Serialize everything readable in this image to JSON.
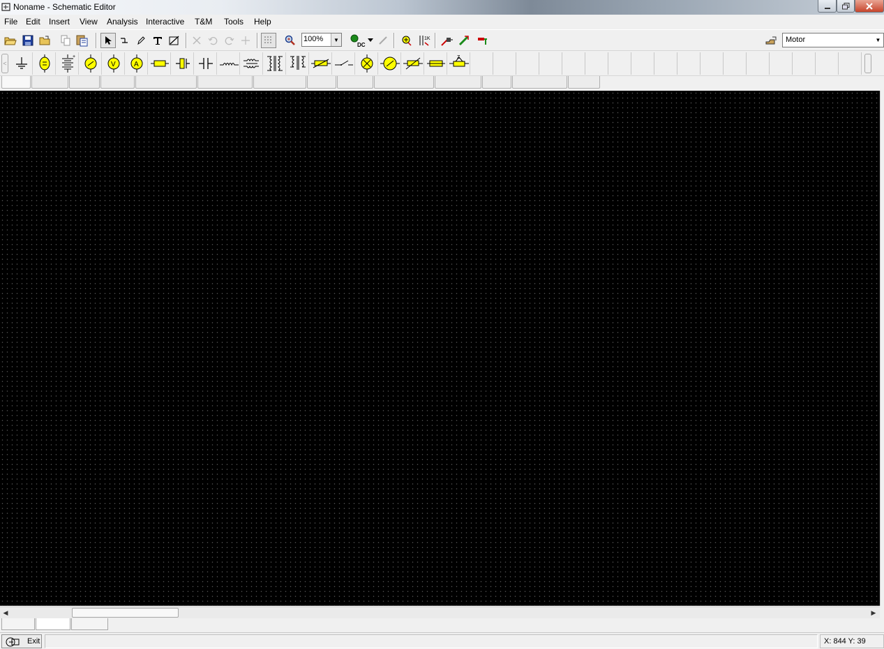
{
  "window": {
    "title": "Noname - Schematic Editor",
    "controls": [
      "minimize",
      "maximize",
      "close"
    ]
  },
  "menubar": {
    "items": [
      {
        "label": "File"
      },
      {
        "label": "Edit"
      },
      {
        "label": "Insert"
      },
      {
        "label": "View"
      },
      {
        "label": "Analysis"
      },
      {
        "label": "Interactive"
      },
      {
        "label": "T&M"
      },
      {
        "label": "Tools"
      },
      {
        "label": "Help"
      }
    ]
  },
  "toolbar": {
    "zoom_value": "100%",
    "component_value": "Motor",
    "dc_label": "DC",
    "buttons": [
      "open-icon",
      "save-icon",
      "open-folder-icon",
      "copy-icon",
      "paste-icon",
      "select-arrow-icon",
      "wire-icon",
      "pencil-icon",
      "text-icon",
      "line-icon",
      "delete-icon",
      "undo-icon",
      "redo-icon",
      "junction-icon",
      "grid-icon",
      "zoom-icon",
      "dc-analysis-icon",
      "probe-icon",
      "meter-icon",
      "component-value-icon",
      "voltage-pin-icon",
      "current-arrow-icon",
      "test-point-icon",
      "component-finder-icon"
    ]
  },
  "components": [
    "ground-icon",
    "battery-icon",
    "multi-battery-icon",
    "voltage-source-icon",
    "voltmeter-icon",
    "ammeter-icon",
    "resistor-icon",
    "capacitor-icon",
    "nonpolar-capacitor-icon",
    "inductor-icon",
    "coupled-inductor-icon",
    "transformer-icon",
    "ideal-transformer-icon",
    "potentiometer-icon",
    "switch-icon",
    "lamp-icon",
    "motor-icon",
    "varistor-icon",
    "fuse-icon",
    "impedance-icon"
  ],
  "statusbar": {
    "exit_label": "Exit",
    "coordinates": "X: 844  Y: 39"
  },
  "colors": {
    "canvas": "#000000",
    "grid_dot": "#555555",
    "component_fill": "#ffff00",
    "chrome": "#f0f0f0"
  }
}
